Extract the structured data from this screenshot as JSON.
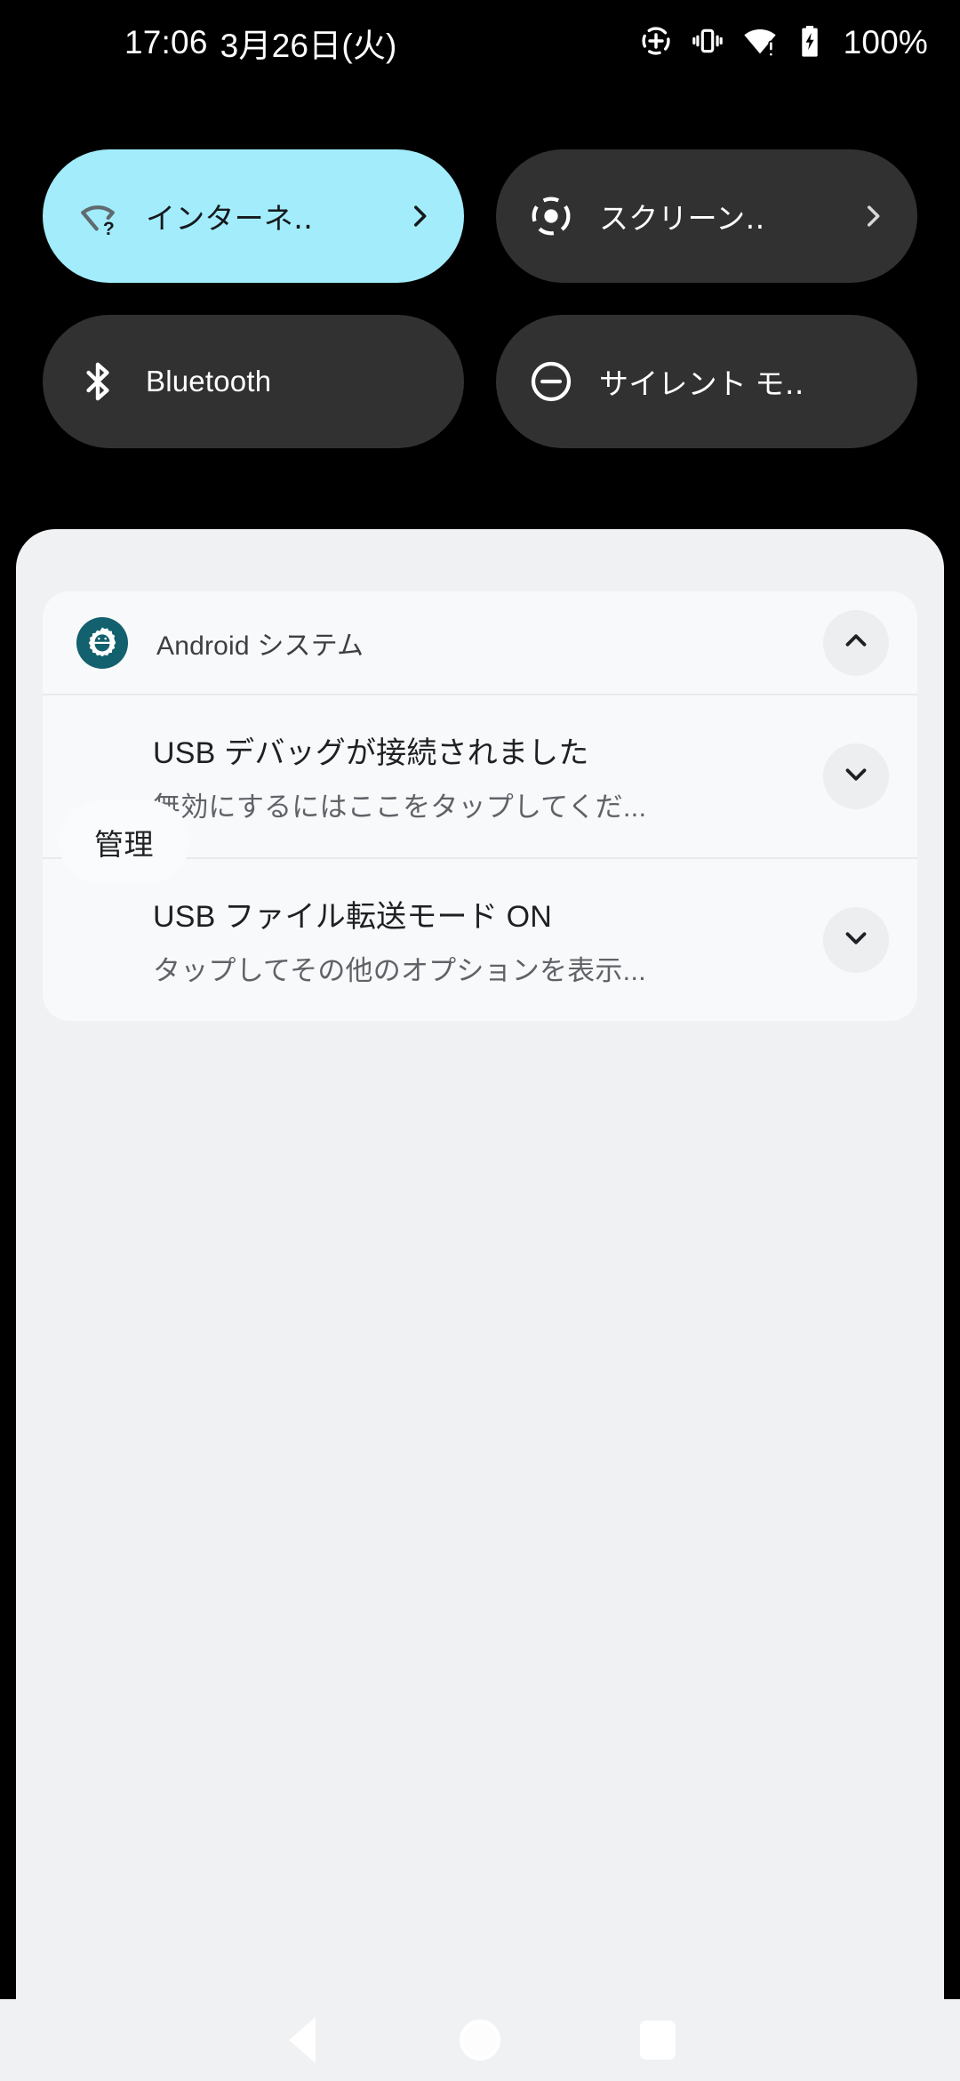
{
  "status_bar": {
    "time": "17:06",
    "date": "3月26日(火)",
    "battery_percent": "100%",
    "icons": [
      "location-crosshair-icon",
      "vibrate-icon",
      "wifi-no-internet-icon",
      "battery-charging-icon"
    ]
  },
  "quick_settings": {
    "tiles": [
      {
        "label": "インターネ‥",
        "icon": "wifi-question-icon",
        "active": true,
        "has_chevron": true
      },
      {
        "label": "スクリーン‥",
        "icon": "screen-record-icon",
        "active": false,
        "has_chevron": true
      },
      {
        "label": "Bluetooth",
        "icon": "bluetooth-icon",
        "active": false,
        "has_chevron": false
      },
      {
        "label": "サイレント モ‥",
        "icon": "do-not-disturb-icon",
        "active": false,
        "has_chevron": false
      }
    ]
  },
  "notification_shade": {
    "group": {
      "app_name": "Android システム",
      "app_icon": "android-system-gear-icon",
      "collapse_icon": "chevron-up-icon"
    },
    "notifications": [
      {
        "title": "USB デバッグが接続されました",
        "body": "無効にするにはここをタップしてくだ...",
        "expand_icon": "chevron-down-icon"
      },
      {
        "title": "USB ファイル転送モード ON",
        "body": "タップしてその他のオプションを表示...",
        "expand_icon": "chevron-down-icon"
      }
    ],
    "manage_label": "管理"
  },
  "nav_bar": {
    "back_label": "戻る",
    "home_label": "ホーム",
    "recents_label": "履歴"
  },
  "colors": {
    "background": "#000000",
    "tile_active": "#a2ecfb",
    "tile_inactive": "#313131",
    "shade_background": "#eff1f3",
    "card_background": "#f8f9fa",
    "app_icon_teal": "#13606e"
  }
}
